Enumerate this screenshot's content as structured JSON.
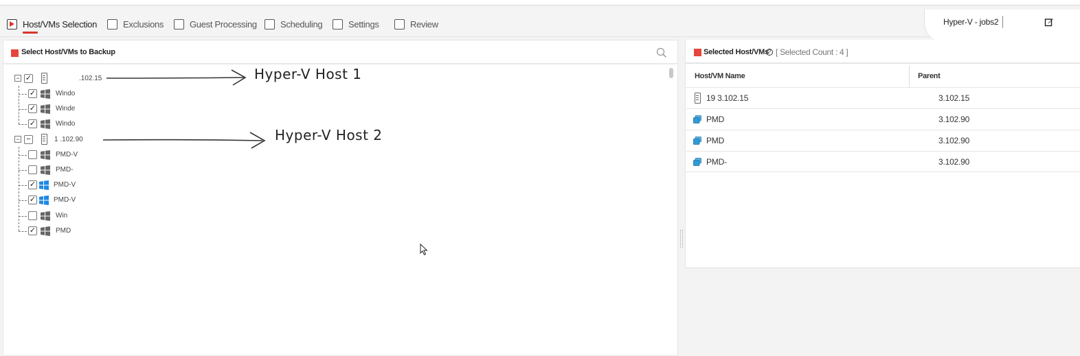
{
  "wizard": {
    "steps": [
      {
        "label": "Host/VMs Selection",
        "active": true
      },
      {
        "label": "Exclusions"
      },
      {
        "label": "Guest Processing"
      },
      {
        "label": "Scheduling"
      },
      {
        "label": "Settings"
      },
      {
        "label": "Review"
      }
    ],
    "job_name": "Hyper-V - jobs2",
    "edit_icon": "edit-icon"
  },
  "left_panel": {
    "title": "Select Host/VMs to Backup",
    "search_icon": "search-icon",
    "tree": [
      {
        "label": ".102.15",
        "checked": "checked",
        "expanded": true,
        "icon": "server-icon",
        "children": [
          {
            "label": "Windo",
            "checked": true,
            "icon": "windows-gray-icon"
          },
          {
            "label": "Winde",
            "checked": true,
            "icon": "windows-gray-icon"
          },
          {
            "label": "Windo",
            "checked": true,
            "icon": "windows-gray-icon"
          }
        ]
      },
      {
        "label": "1 .102.90",
        "checked": "partial",
        "expanded": true,
        "icon": "server-icon",
        "children": [
          {
            "label": "PMD-V",
            "checked": false,
            "icon": "windows-gray-icon"
          },
          {
            "label": "PMD-",
            "checked": false,
            "icon": "windows-gray-icon"
          },
          {
            "label": "PMD-V",
            "checked": true,
            "icon": "windows-blue-icon"
          },
          {
            "label": "PMD-V",
            "checked": true,
            "icon": "windows-blue-icon"
          },
          {
            "label": "Win",
            "checked": false,
            "icon": "windows-gray-icon"
          },
          {
            "label": "PMD",
            "checked": true,
            "icon": "windows-gray-icon"
          }
        ]
      }
    ],
    "annotations": [
      "Hyper-V Host 1",
      "Hyper-V Host 2"
    ]
  },
  "right_panel": {
    "title": "Selected Host/VMs",
    "help_icon": "help-icon",
    "count_text": "[ Selected Count : 4 ]",
    "columns": [
      "Host/VM Name",
      "Parent"
    ],
    "rows": [
      {
        "name": "19 3.102.15",
        "parent": "3.102.15",
        "icon": "server-icon"
      },
      {
        "name": "PMD",
        "parent": "3.102.90",
        "icon": "vm-icon"
      },
      {
        "name": "PMD",
        "parent": "3.102.90",
        "icon": "vm-icon"
      },
      {
        "name": "PMD-",
        "parent": "3.102.90",
        "icon": "vm-icon"
      }
    ]
  },
  "colors": {
    "accent": "#d9342b",
    "square": "#e5463c",
    "windows_blue": "#1e88e5"
  }
}
